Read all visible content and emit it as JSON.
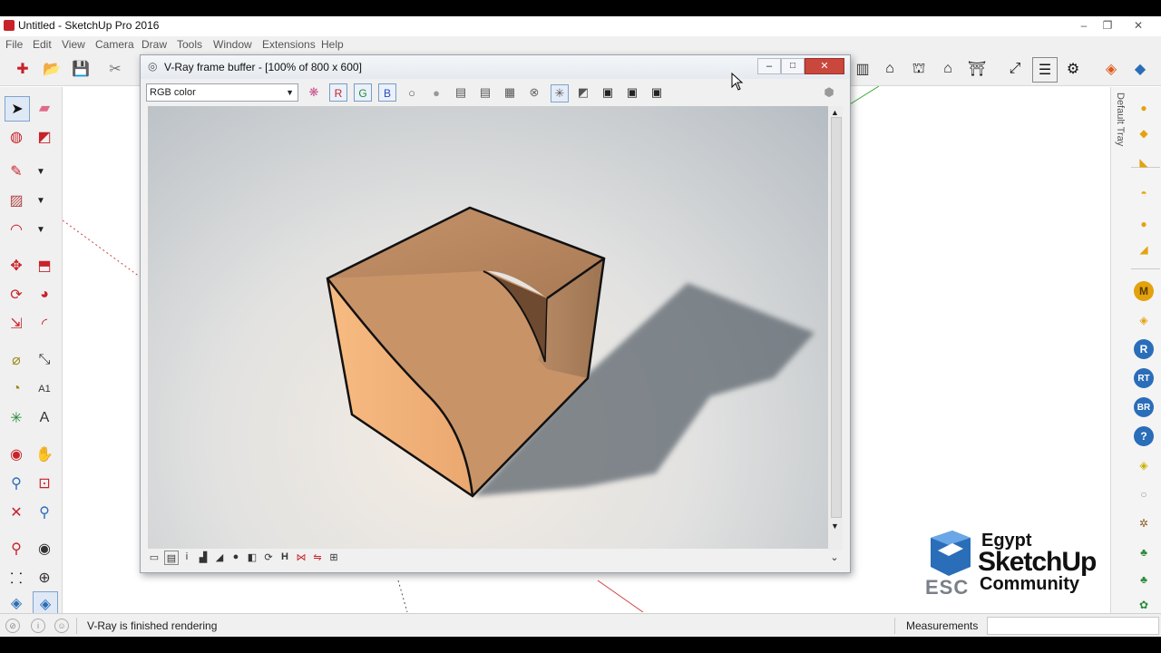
{
  "window": {
    "title": "Untitled - SketchUp Pro 2016",
    "minimize": "–",
    "restore": "❐",
    "close": "✕"
  },
  "menu": [
    "File",
    "Edit",
    "View",
    "Camera",
    "Draw",
    "Tools",
    "Window",
    "Extensions",
    "Help"
  ],
  "vfb": {
    "title": "V-Ray frame buffer - [100% of 800 x 600]",
    "channel": "RGB color",
    "channel_buttons": [
      "R",
      "G",
      "B"
    ]
  },
  "tray": {
    "label": "Default Tray",
    "buttons": [
      "M",
      "R",
      "RT",
      "BR",
      "?"
    ]
  },
  "status": {
    "message": "V-Ray is finished rendering",
    "measurements_label": "Measurements",
    "measurements_value": ""
  },
  "logo": {
    "abbr": "ESC",
    "line1": "Egypt",
    "line2": "SketchUp",
    "line3": "Community"
  },
  "colors": {
    "accent_red": "#c8222a",
    "cube_face": "#f2b27a",
    "tray_gold": "#e3a20e",
    "tray_blue": "#2a6db8"
  }
}
